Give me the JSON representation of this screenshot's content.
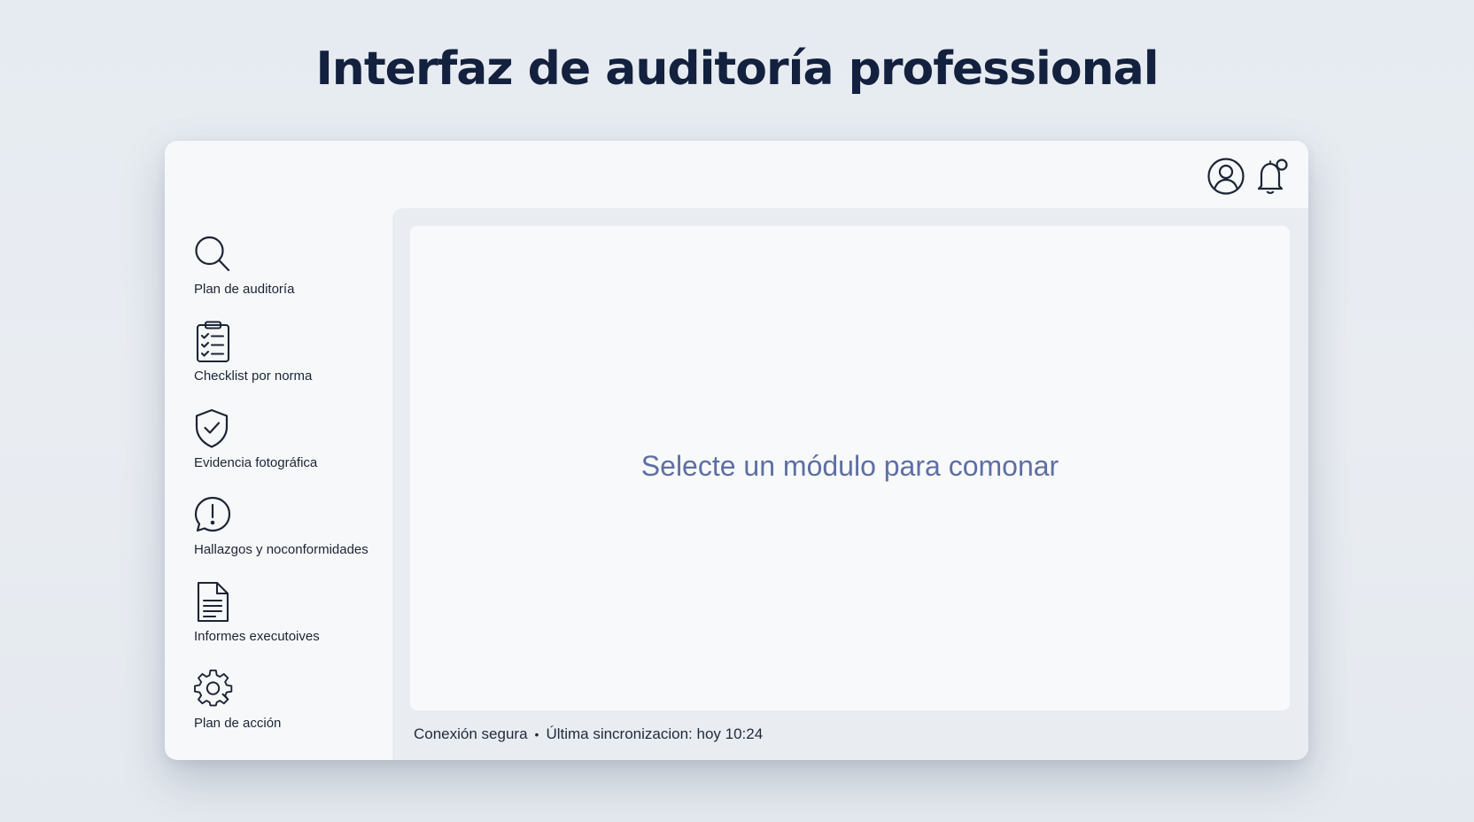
{
  "page": {
    "title": "Interfaz de auditoría professional"
  },
  "topbar": {
    "icons": [
      "user-account-icon",
      "notification-bell-icon"
    ]
  },
  "sidebar": {
    "items": [
      {
        "label": "Plan de auditoría",
        "icon": "search-icon"
      },
      {
        "label": "Checklist por norma",
        "icon": "clipboard-checklist-icon"
      },
      {
        "label": "Evidencia fotográfica",
        "icon": "shield-check-icon"
      },
      {
        "label": "Hallazgos y noconformidades",
        "icon": "alert-bubble-icon"
      },
      {
        "label": "Informes executoives",
        "icon": "document-icon"
      },
      {
        "label": "Plan de acción",
        "icon": "gear-icon"
      }
    ]
  },
  "main": {
    "placeholder": "Selecte un módulo para comonar"
  },
  "status": {
    "connection": "Conexión segura",
    "separator": "•",
    "sync": "Última sincronizacion: hoy 10:24"
  },
  "colors": {
    "title": "#13213f",
    "placeholder_text": "#5e6fa3",
    "icon_stroke": "#1c2536",
    "background": "#e7ecf1"
  }
}
